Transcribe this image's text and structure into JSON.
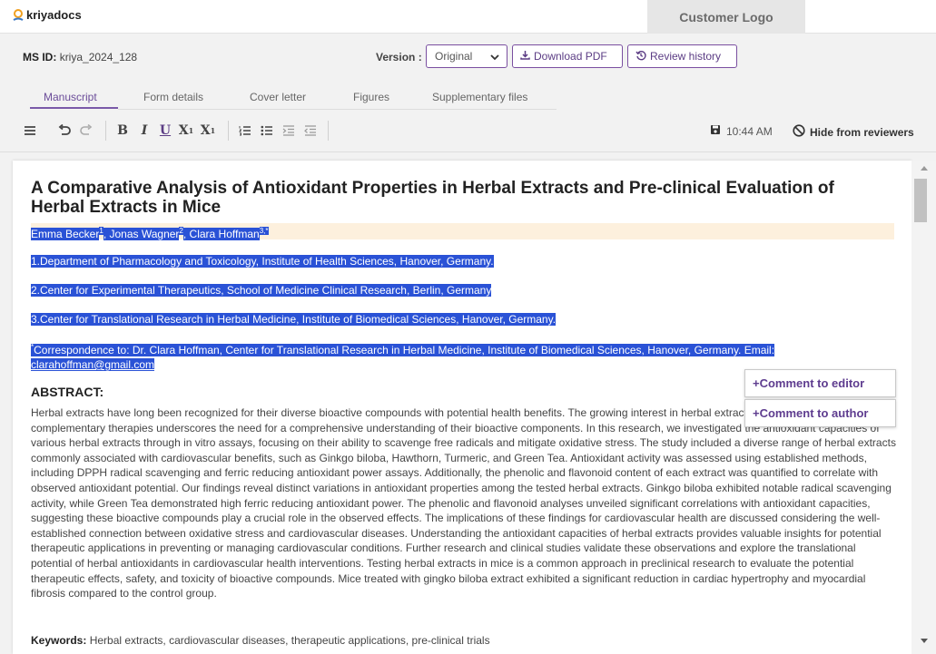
{
  "brand": {
    "name": "kriyadocs"
  },
  "customer_logo": "Customer Logo",
  "info": {
    "ms_id_label": "MS ID:",
    "ms_id_value": "kriya_2024_128",
    "version_label": "Version :",
    "version_value": "Original",
    "download_label": "Download PDF",
    "history_label": "Review history"
  },
  "tabs": [
    "Manuscript",
    "Form details",
    "Cover letter",
    "Figures",
    "Supplementary files"
  ],
  "toolbar": {
    "saved_time": "10:44 AM",
    "hide_label": "Hide from reviewers",
    "icons": [
      "menu-icon",
      "undo-icon",
      "redo-icon",
      "bold-icon",
      "italic-icon",
      "underline-icon",
      "subscript-icon",
      "superscript-icon",
      "ordered-list-icon",
      "unordered-list-icon",
      "indent-icon",
      "outdent-icon"
    ]
  },
  "doc": {
    "title": "A Comparative Analysis of Antioxidant Properties in Herbal Extracts and Pre-clinical Evaluation of Herbal Extracts in Mice",
    "authors": {
      "a1": "Emma Becker",
      "a1_sup": "1",
      "sep1": ", ",
      "a2": "Jonas Wagner",
      "a2_sup": "2",
      "sep2": ", ",
      "a3": "Clara Hoffman",
      "a3_sup": "3,*"
    },
    "aff1": "1.Department of Pharmacology and Toxicology, Institute of Health Sciences, Hanover, Germany.",
    "aff2": "2.Center for Experimental Therapeutics, School of Medicine Clinical Research, Berlin, Germany",
    "aff3": "3.Center for Translational Research in Herbal Medicine, Institute of Biomedical Sciences, Hanover, Germany.",
    "corr_sup": "*",
    "corr_line1": "Correspondence to: Dr. Clara Hoffman, Center for Translational Research in Herbal Medicine, Institute of Biomedical Sciences, Hanover, Germany. Email:",
    "corr_email": "clarahoffman@gmail.com",
    "abstract_heading": "ABSTRACT:",
    "abstract": "Herbal extracts have long been recognized for their diverse bioactive compounds with potential health benefits. The growing interest in herbal extracts as alternative or complementary therapies underscores the need for a comprehensive understanding of their bioactive components. In this research, we investigated the antioxidant capacities of various herbal extracts through in vitro assays, focusing on their ability to scavenge free radicals and mitigate oxidative stress. The study included a diverse range of herbal extracts commonly associated with cardiovascular benefits, such as Ginkgo biloba, Hawthorn, Turmeric, and Green Tea. Antioxidant activity was assessed using established methods, including DPPH radical scavenging and ferric reducing antioxidant power assays. Additionally, the phenolic and flavonoid content of each extract was quantified to correlate with observed antioxidant potential. Our findings reveal distinct variations in antioxidant properties among the tested herbal extracts. Ginkgo biloba exhibited notable radical scavenging activity, while Green Tea demonstrated high ferric reducing antioxidant power. The phenolic and flavonoid analyses unveiled significant correlations with antioxidant capacities, suggesting these bioactive compounds play a crucial role in the observed effects. The implications of these findings for cardiovascular health are discussed considering the well-established connection between oxidative stress and cardiovascular diseases. Understanding the antioxidant capacities of herbal extracts provides valuable insights for potential therapeutic applications in preventing or managing cardiovascular conditions. Further research and clinical studies validate these observations and explore the translational potential of herbal antioxidants in cardiovascular health interventions. Testing herbal extracts in mice is a common approach in preclinical research to evaluate the potential therapeutic effects, safety, and toxicity of bioactive compounds. Mice treated with gingko biloba extract exhibited a significant reduction in cardiac hypertrophy and myocardial fibrosis compared to the control group.",
    "keywords_label": "Keywords:",
    "keywords_value": "Herbal extracts, cardiovascular diseases, therapeutic applications, pre-clinical trials"
  },
  "popup": {
    "editor": "+Comment to editor",
    "author": "+Comment to author"
  }
}
